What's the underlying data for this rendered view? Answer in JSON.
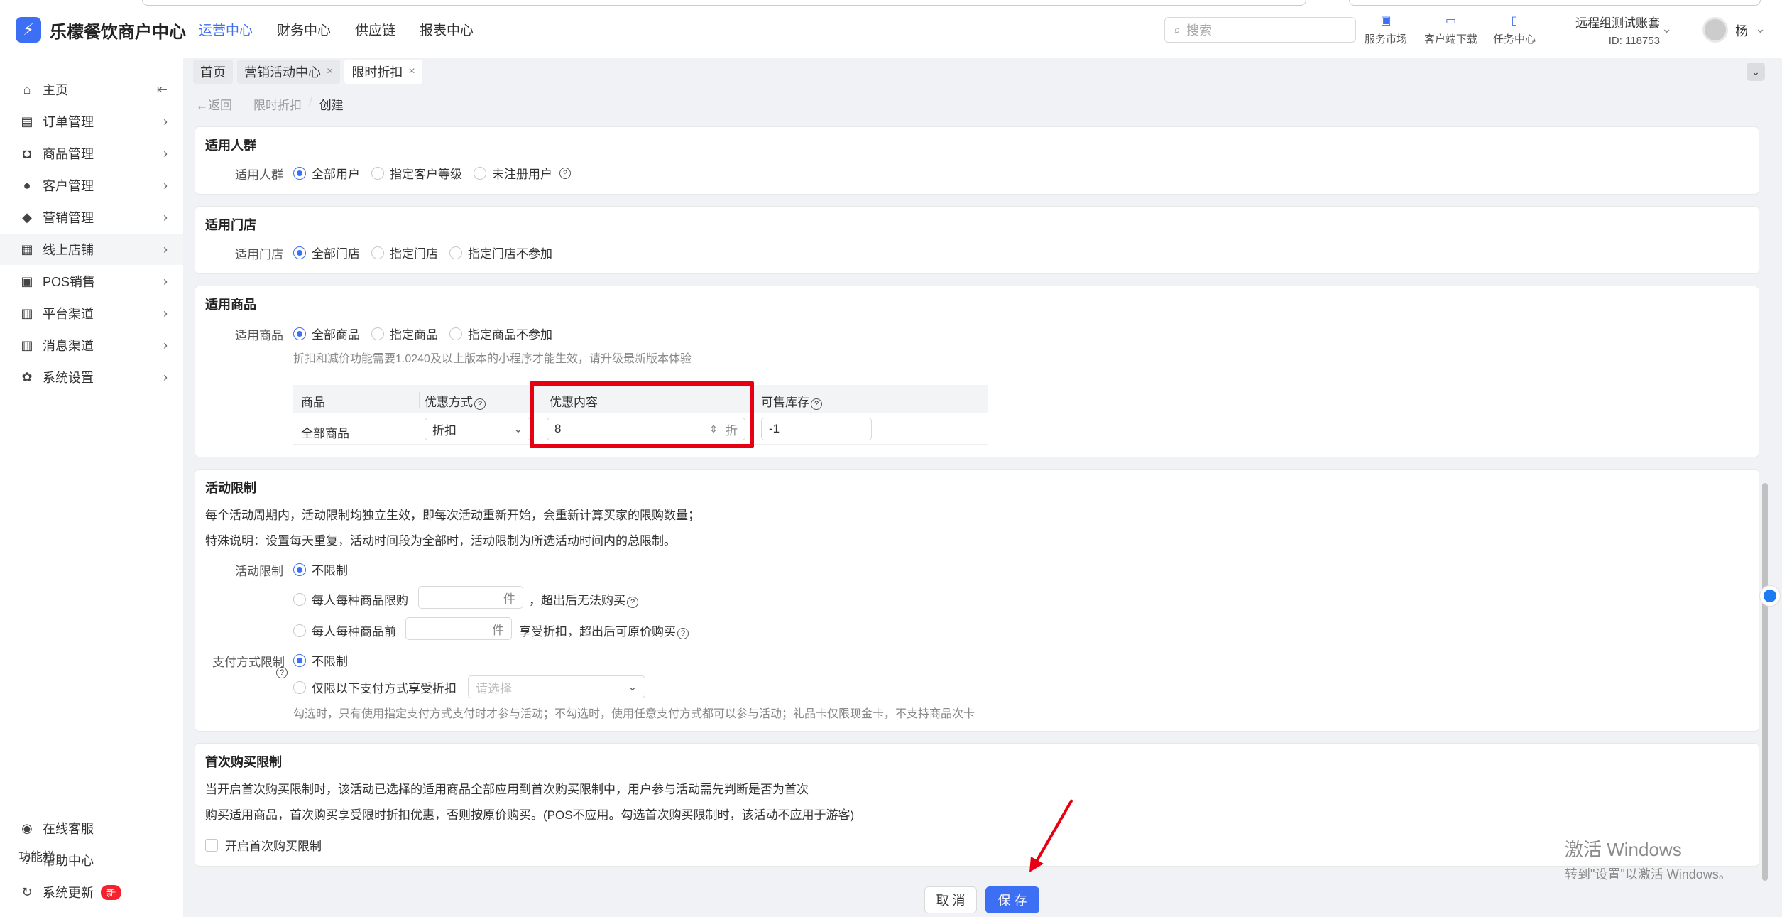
{
  "app": {
    "logo_glyph": "⚡",
    "title": "乐檬餐饮商户中心"
  },
  "topnav": [
    "运营中心",
    "财务中心",
    "供应链",
    "报表中心"
  ],
  "search": {
    "placeholder": "搜索"
  },
  "tools": [
    {
      "label": "服务市场",
      "icon": "shop-icon"
    },
    {
      "label": "客户端下载",
      "icon": "download-folder-icon"
    },
    {
      "label": "任务中心",
      "icon": "clipboard-icon"
    }
  ],
  "account": {
    "name": "远程组测试账套",
    "id": "ID: 118753",
    "user": "杨"
  },
  "sidebar": {
    "items": [
      {
        "label": "主页",
        "icon": "⌂"
      },
      {
        "label": "订单管理",
        "icon": "▤"
      },
      {
        "label": "商品管理",
        "icon": "◘"
      },
      {
        "label": "客户管理",
        "icon": "●"
      },
      {
        "label": "营销管理",
        "icon": "◆"
      },
      {
        "label": "线上店铺",
        "icon": "▦"
      },
      {
        "label": "POS销售",
        "icon": "▣"
      },
      {
        "label": "平台渠道",
        "icon": "▥"
      },
      {
        "label": "消息渠道",
        "icon": "▥"
      },
      {
        "label": "系统设置",
        "icon": "✿"
      }
    ],
    "func_title": "功能栏",
    "func_items": [
      {
        "label": "在线客服",
        "icon": "◉"
      },
      {
        "label": "帮助中心",
        "icon": "?"
      },
      {
        "label": "系统更新",
        "icon": "↻",
        "badge": "新"
      }
    ]
  },
  "tabs": [
    {
      "label": "首页",
      "closable": false
    },
    {
      "label": "营销活动中心",
      "closable": true
    },
    {
      "label": "限时折扣",
      "closable": true
    }
  ],
  "breadcrumb": {
    "back": "返回",
    "parent": "限时折扣",
    "sep": "/",
    "current": "创建"
  },
  "audience": {
    "title": "适用人群",
    "label": "适用人群",
    "options": [
      "全部用户",
      "指定客户等级",
      "未注册用户"
    ],
    "selected": 0
  },
  "stores": {
    "title": "适用门店",
    "label": "适用门店",
    "options": [
      "全部门店",
      "指定门店",
      "指定门店不参加"
    ],
    "selected": 0
  },
  "goods": {
    "title": "适用商品",
    "label": "适用商品",
    "options": [
      "全部商品",
      "指定商品",
      "指定商品不参加"
    ],
    "selected": 0,
    "note": "折扣和减价功能需要1.0240及以上版本的小程序才能生效，请升级最新版本体验",
    "table": {
      "headers": [
        "商品",
        "优惠方式",
        "优惠内容",
        "可售库存"
      ],
      "row": {
        "product": "全部商品",
        "method": "折扣",
        "content": "8",
        "content_suffix": "折",
        "stock": "-1"
      }
    }
  },
  "limits": {
    "title": "活动限制",
    "desc1": "每个活动周期内，活动限制均独立生效，即每次活动重新开始，会重新计算买家的限购数量；",
    "desc2": "特殊说明：设置每天重复，活动时间段为全部时，活动限制为所选活动时间内的总限制。",
    "label": "活动限制",
    "opt_none": "不限制",
    "opt_each_prefix": "每人每种商品限购",
    "opt_each_unit": "件",
    "opt_each_suffix": "，超出后无法购买",
    "opt_first_prefix": "每人每种商品前",
    "opt_first_unit": "件",
    "opt_first_suffix": "享受折扣，超出后可原价购买",
    "pay_label": "支付方式限制",
    "pay_none": "不限制",
    "pay_only": "仅限以下支付方式享受折扣",
    "pay_placeholder": "请选择",
    "pay_note": "勾选时，只有使用指定支付方式支付时才参与活动；不勾选时，使用任意支付方式都可以参与活动；礼品卡仅限现金卡，不支持商品次卡"
  },
  "first_buy": {
    "title": "首次购买限制",
    "desc1": "当开启首次购买限制时，该活动已选择的适用商品全部应用到首次购买限制中，用户参与活动需先判断是否为首次",
    "desc2": "购买适用商品，首次购买享受限时折扣优惠，否则按原价购买。(POS不应用。勾选首次购买限制时，该活动不应用于游客)",
    "checkbox": "开启首次购买限制"
  },
  "footer": {
    "cancel": "取 消",
    "save": "保 存"
  },
  "watermark": {
    "line1": "激活 Windows",
    "line2": "转到\"设置\"以激活 Windows。"
  },
  "colors": {
    "accent": "#3d6ff5",
    "highlight": "#e60012"
  }
}
